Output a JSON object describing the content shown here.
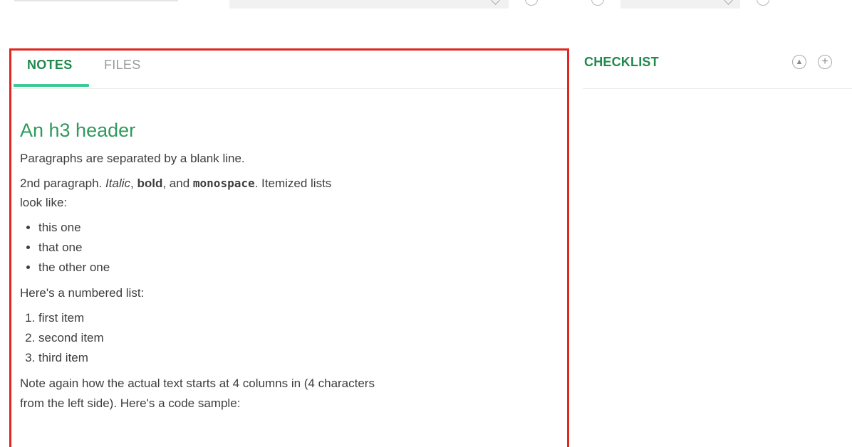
{
  "tabs": {
    "notes": "NOTES",
    "files": "FILES"
  },
  "note": {
    "heading": "An h3 header",
    "para1": "Paragraphs are separated by a blank line.",
    "para2": {
      "lead": "2nd paragraph. ",
      "italic": "Italic",
      "comma": ", ",
      "bold": "bold",
      "and": ", and ",
      "mono": "monospace",
      "tail": ". Itemized lists",
      "line2": "look like:"
    },
    "bullets": [
      "this one",
      "that one",
      "the other one"
    ],
    "numbered_intro": "Here's a numbered list:",
    "numbered": [
      "first item",
      "second item",
      "third item"
    ],
    "para_last_1": "Note again how the actual text starts at 4 columns in (4 characters",
    "para_last_2": "from the left side). Here's a code sample:"
  },
  "checklist": {
    "title": "CHECKLIST",
    "user_icon": "user-circle-icon",
    "add_icon": "plus-circle-icon"
  },
  "colors": {
    "accent_green": "#1f8a4c",
    "tab_underline": "#3fc995",
    "highlight_border": "#e0261f"
  }
}
